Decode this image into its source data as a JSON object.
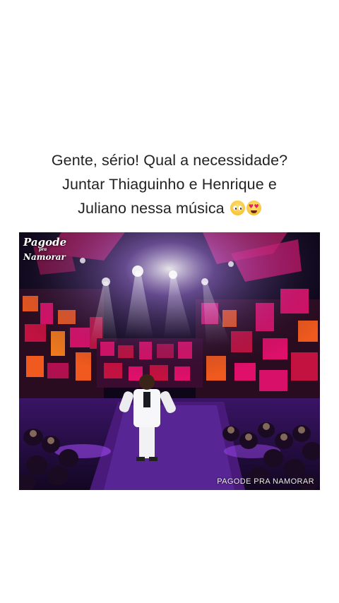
{
  "post": {
    "caption_lines": [
      "Gente, sério! Qual a necessidade?",
      "Juntar Thiaguinho e Henrique e",
      "Juliano nessa música"
    ],
    "caption_emojis": [
      "pleading-face-emoji",
      "heart-eyes-emoji"
    ]
  },
  "video": {
    "logo_line1": "Pagode",
    "logo_line2": "pra",
    "logo_line3": "Namorar",
    "watermark": "PAGODE PRA NAMORAR",
    "colors": {
      "stage_magenta": "#e0106a",
      "stage_orange": "#f05a1e",
      "stage_purple": "#7a2cd6",
      "background": "#0d0618"
    }
  }
}
